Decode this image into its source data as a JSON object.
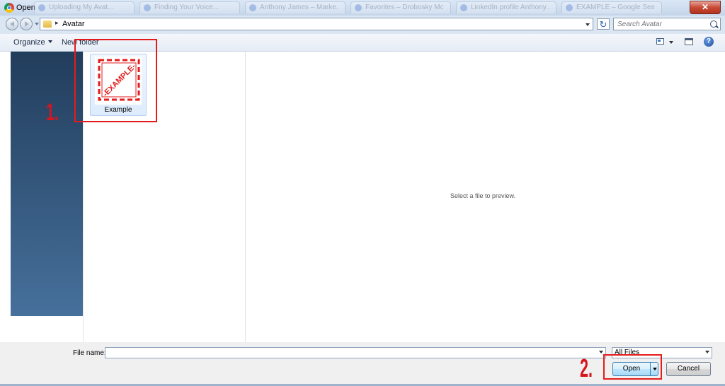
{
  "window": {
    "title": "Open",
    "close_label": "✕",
    "background_tabs": [
      "Uploading My Avat...",
      "Finding Your Voice...",
      "Anthony James – Marke...",
      "Favorites – Drobosky Morris...",
      "LinkedIn profile Anthony...",
      "EXAMPLE – Google Search"
    ]
  },
  "address": {
    "breadcrumb_separator": "▸",
    "current_folder": "Avatar",
    "search_placeholder": "Search Avatar",
    "refresh_glyph": "↻"
  },
  "toolbar": {
    "organize_label": "Organize",
    "new_folder_label": "New folder",
    "help_glyph": "?"
  },
  "files": [
    {
      "name": "Example",
      "stamp_text": "-EXAMPLE-"
    }
  ],
  "preview": {
    "empty_text": "Select a file to preview."
  },
  "bottom": {
    "file_name_label": "File name:",
    "file_name_value": "",
    "file_type_value": "All Files",
    "open_label": "Open",
    "cancel_label": "Cancel"
  },
  "annotations": {
    "step1": "1.",
    "step2": "2.",
    "color": "#e31b1b"
  }
}
